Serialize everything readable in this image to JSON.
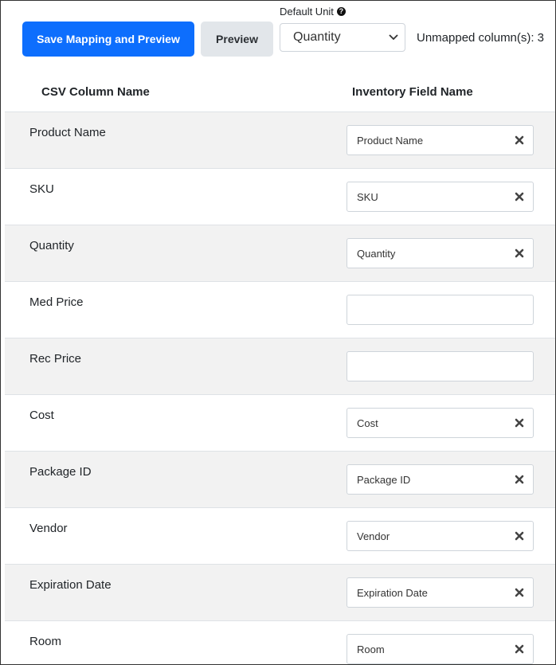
{
  "toolbar": {
    "save_preview_label": "Save Mapping and Preview",
    "preview_label": "Preview",
    "default_unit_label": "Default Unit",
    "default_unit_value": "Quantity",
    "unmapped_label": "Unmapped column(s):",
    "unmapped_count": "3"
  },
  "table": {
    "headers": {
      "csv": "CSV Column Name",
      "inventory": "Inventory Field Name"
    },
    "rows": [
      {
        "csv": "Product Name",
        "field": "Product Name"
      },
      {
        "csv": "SKU",
        "field": "SKU"
      },
      {
        "csv": "Quantity",
        "field": "Quantity"
      },
      {
        "csv": "Med Price",
        "field": ""
      },
      {
        "csv": "Rec Price",
        "field": ""
      },
      {
        "csv": "Cost",
        "field": "Cost"
      },
      {
        "csv": "Package ID",
        "field": "Package ID"
      },
      {
        "csv": "Vendor",
        "field": "Vendor"
      },
      {
        "csv": "Expiration Date",
        "field": "Expiration Date"
      },
      {
        "csv": "Room",
        "field": "Room"
      }
    ]
  },
  "colors": {
    "primary": "#0d6efd",
    "secondary": "#e2e6ea",
    "row_alt": "#f2f2f2"
  },
  "icons": {
    "help": "question-circle-icon",
    "clear": "times-icon",
    "select_caret": "chevron-down-icon"
  }
}
